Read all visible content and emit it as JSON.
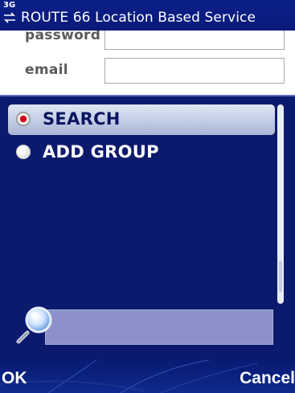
{
  "status_bar": {
    "network_label": "3G",
    "app_title": "ROUTE 66 Location Based Service"
  },
  "background_form": {
    "fields": [
      {
        "label": "password",
        "value": ""
      },
      {
        "label": "email",
        "value": ""
      }
    ]
  },
  "menu": {
    "items": [
      {
        "label": "SEARCH",
        "selected": true
      },
      {
        "label": "ADD GROUP",
        "selected": false
      }
    ],
    "search": {
      "value": ""
    }
  },
  "softkeys": {
    "left_label": "OK",
    "right_label": "Cancel"
  },
  "colors": {
    "popup_background": "#0c1a6e",
    "title_bar": "#0b1f8a",
    "highlight": "#a9b6d6",
    "radio_selected": "#d3001a",
    "search_field": "#8c92c9"
  },
  "icons": {
    "network": "network-arrows-icon",
    "search": "magnifier-icon",
    "radio_on": "radio-selected-icon",
    "radio_off": "radio-unselected-icon"
  }
}
